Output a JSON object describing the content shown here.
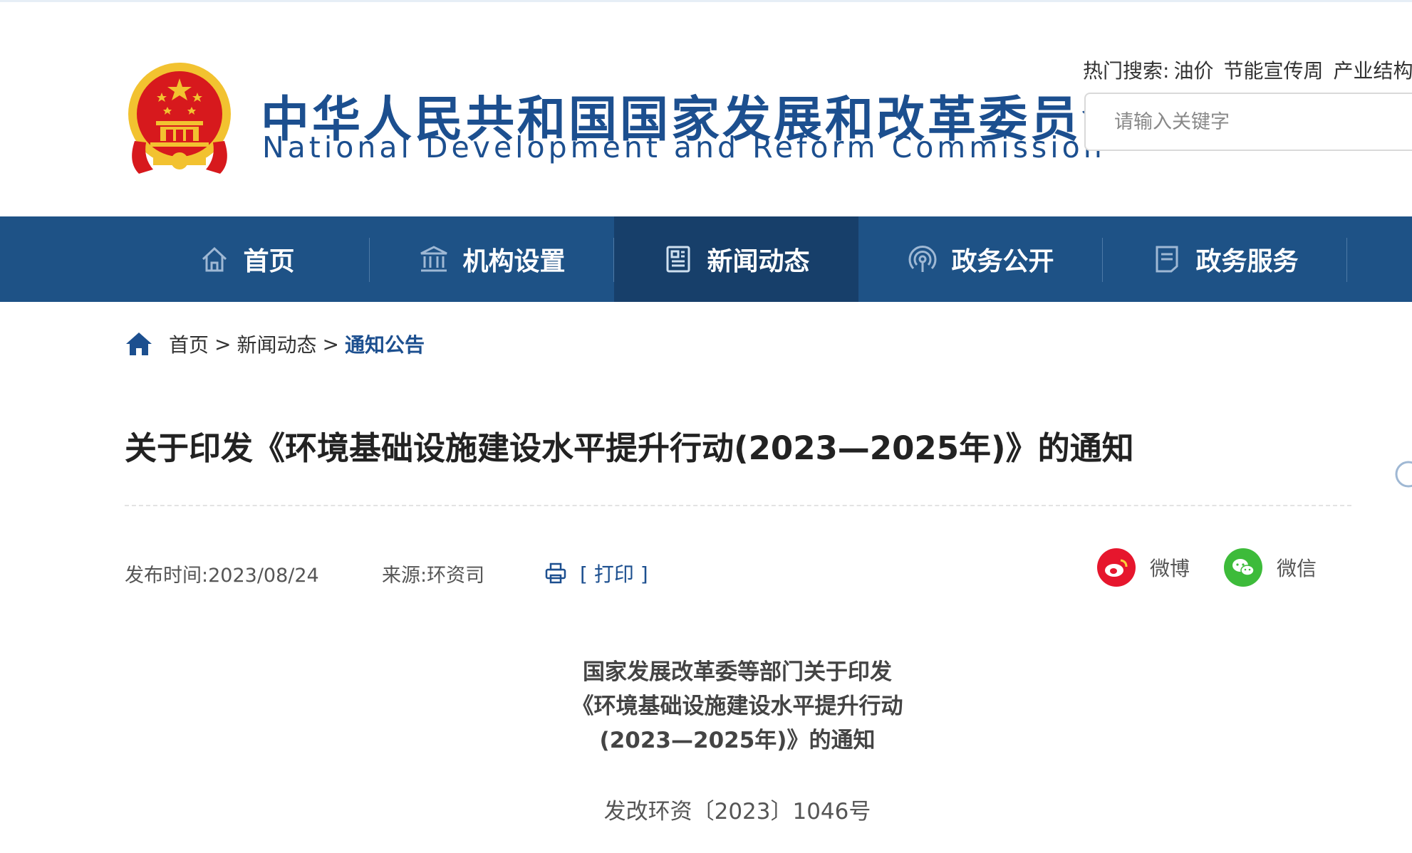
{
  "header": {
    "title_cn": "中华人民共和国国家发展和改革委员会",
    "title_en": "National Development and Reform Commission",
    "hot_search_label": "热门搜索:",
    "hot_terms": [
      "油价",
      "节能宣传周",
      "产业结构"
    ],
    "search_placeholder": "请输入关键字"
  },
  "nav": {
    "items": [
      {
        "label": "首页",
        "icon": "home-icon"
      },
      {
        "label": "机构设置",
        "icon": "institution-icon"
      },
      {
        "label": "新闻动态",
        "icon": "news-icon"
      },
      {
        "label": "政务公开",
        "icon": "broadcast-icon"
      },
      {
        "label": "政务服务",
        "icon": "service-icon"
      }
    ],
    "active": "新闻动态"
  },
  "breadcrumb": {
    "items": [
      "首页",
      "新闻动态",
      "通知公告"
    ],
    "separator": ">"
  },
  "article": {
    "title": "关于印发《环境基础设施建设水平提升行动(2023—2025年)》的通知",
    "publish_label": "发布时间:",
    "publish_date": "2023/08/24",
    "source_label": "来源:",
    "source": "环资司",
    "print_label": "[ 打印 ]",
    "share": [
      {
        "label": "微博",
        "icon": "weibo-icon",
        "color": "#e6162d"
      },
      {
        "label": "微信",
        "icon": "wechat-icon",
        "color": "#3dbb3a"
      }
    ],
    "subtitle_lines": [
      "国家发展改革委等部门关于印发",
      "《环境基础设施建设水平提升行动",
      "(2023—2025年)》的通知"
    ],
    "doc_number": "发改环资〔2023〕1046号"
  },
  "colors": {
    "brand_blue": "#1c4f8f",
    "nav_bg": "#1e5286",
    "nav_active": "#173f6a",
    "emblem_red": "#d7191d",
    "emblem_gold": "#f2c230"
  }
}
